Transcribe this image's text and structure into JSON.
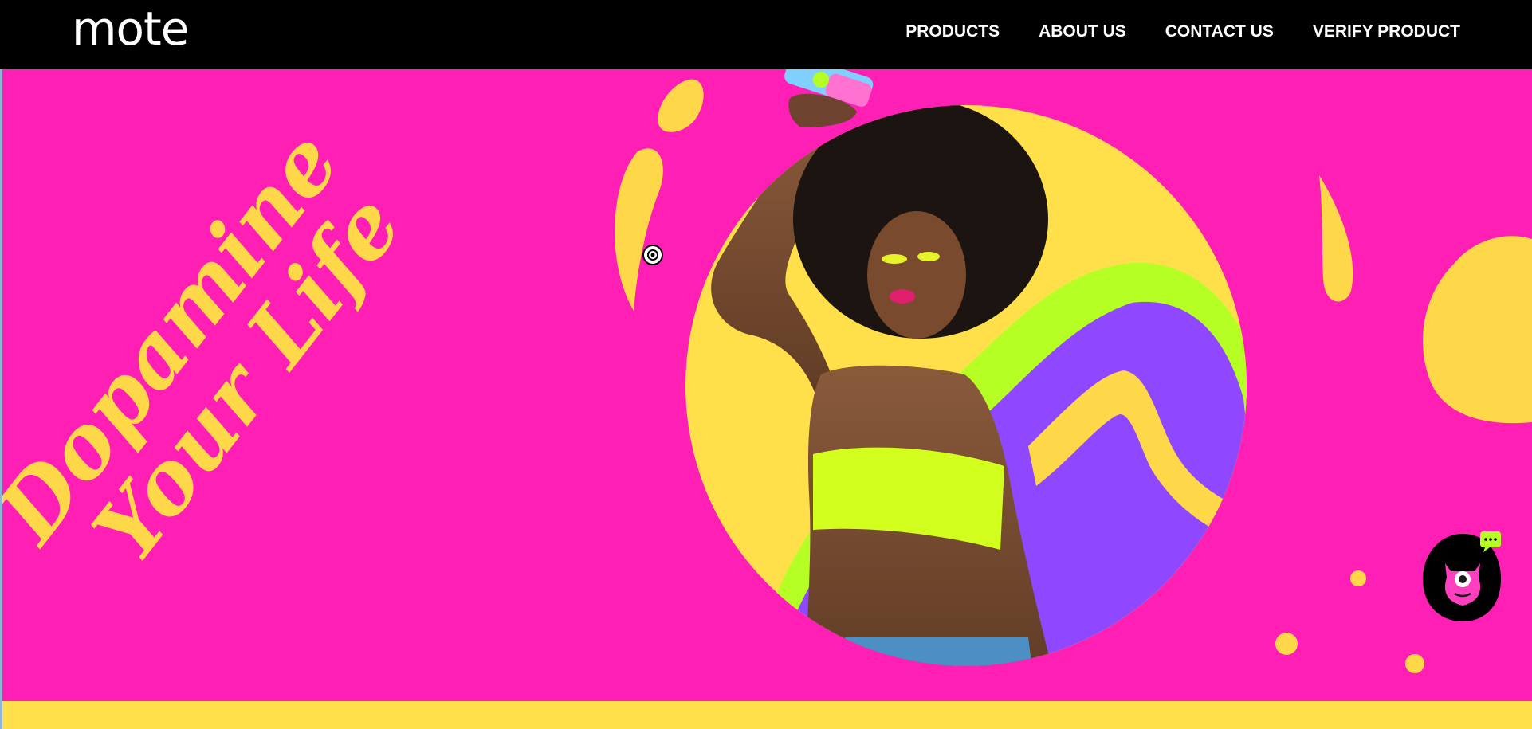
{
  "brand": {
    "logo_text": "mote"
  },
  "nav": {
    "items": [
      {
        "label": "PRODUCTS"
      },
      {
        "label": "ABOUT US"
      },
      {
        "label": "CONTACT US"
      },
      {
        "label": "VERIFY PRODUCT"
      }
    ]
  },
  "hero": {
    "headline_line1": "Dopamine",
    "headline_line2": "Your Life",
    "image_description": "hero-photo"
  },
  "widgets": {
    "chat_icon": "chat-bubble-icon",
    "mascot_icon": "pink-cyclops-monster-icon"
  },
  "colors": {
    "background": "#ff1fb4",
    "accent_yellow": "#ffd84a",
    "nav_background": "#000000",
    "lime": "#b6ff24",
    "purple": "#8f48ff"
  }
}
